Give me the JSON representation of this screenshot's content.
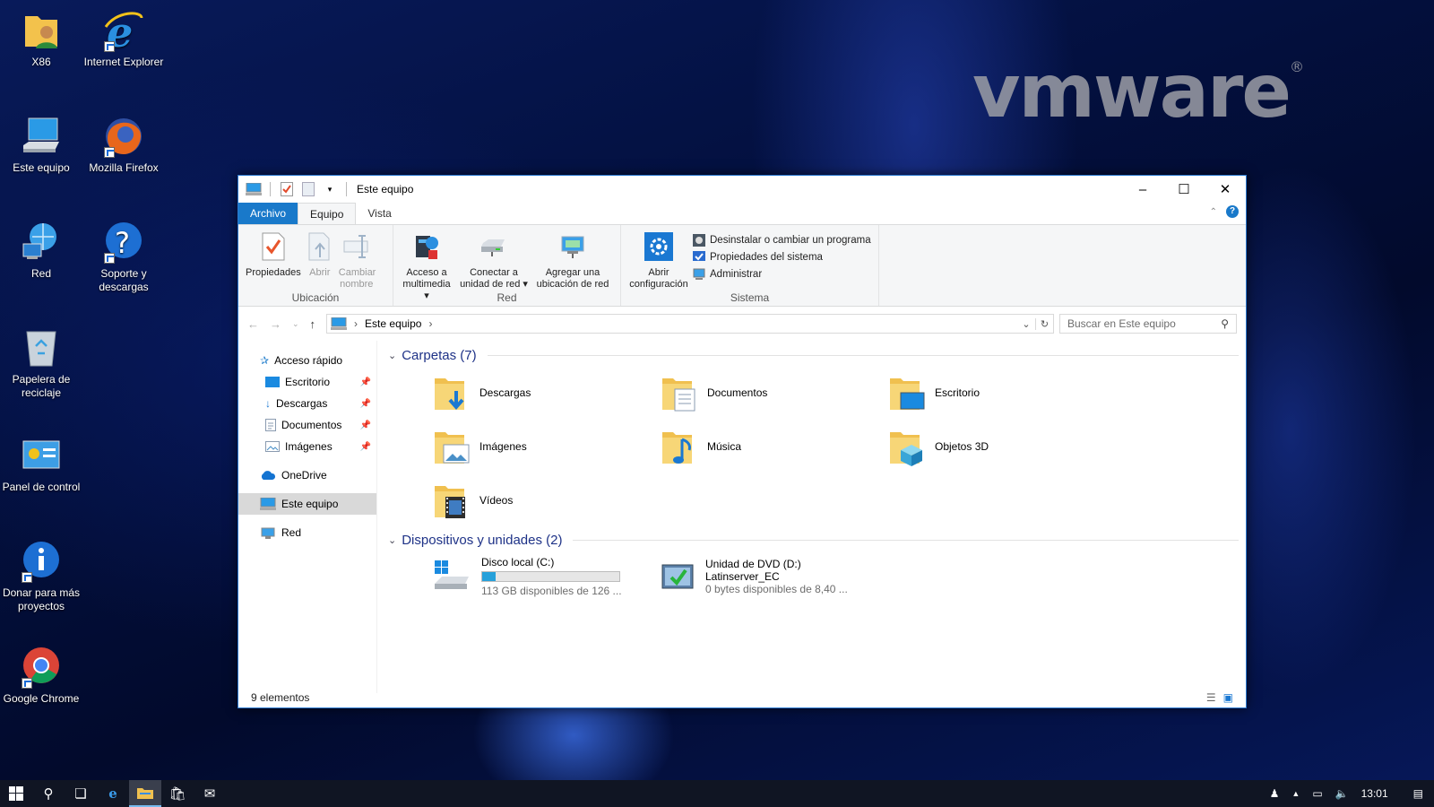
{
  "desktop": {
    "brand": "vmware",
    "icons": [
      {
        "label": "X86"
      },
      {
        "label": "Internet Explorer"
      },
      {
        "label": "Este equipo"
      },
      {
        "label": "Mozilla Firefox"
      },
      {
        "label": "Red"
      },
      {
        "label": "Soporte y descargas"
      },
      {
        "label": "Papelera de reciclaje"
      },
      {
        "label": "Panel de control"
      },
      {
        "label": "Donar para más proyectos"
      },
      {
        "label": "Google Chrome"
      }
    ]
  },
  "window": {
    "title": "Este equipo",
    "tabs": {
      "file": "Archivo",
      "computer": "Equipo",
      "view": "Vista"
    },
    "ribbon": {
      "location": {
        "label": "Ubicación",
        "properties": "Propiedades",
        "open": "Abrir",
        "rename": "Cambiar nombre"
      },
      "network": {
        "label": "Red",
        "media": "Acceso a multimedia",
        "map_drive": "Conectar a unidad de red",
        "add_location": "Agregar una ubicación de red"
      },
      "system": {
        "label": "Sistema",
        "open_settings": "Abrir configuración",
        "uninstall": "Desinstalar o cambiar un programa",
        "sys_props": "Propiedades del sistema",
        "manage": "Administrar"
      }
    },
    "address": {
      "path": "Este equipo",
      "search_placeholder": "Buscar en Este equipo"
    },
    "nav": {
      "quick_access": "Acceso rápido",
      "quick_items": [
        {
          "label": "Escritorio"
        },
        {
          "label": "Descargas"
        },
        {
          "label": "Documentos"
        },
        {
          "label": "Imágenes"
        }
      ],
      "onedrive": "OneDrive",
      "this_pc": "Este equipo",
      "network": "Red"
    },
    "folders_header": "Carpetas (7)",
    "folders": [
      {
        "name": "Descargas"
      },
      {
        "name": "Documentos"
      },
      {
        "name": "Escritorio"
      },
      {
        "name": "Imágenes"
      },
      {
        "name": "Música"
      },
      {
        "name": "Objetos 3D"
      },
      {
        "name": "Vídeos"
      }
    ],
    "devices_header": "Dispositivos y unidades (2)",
    "drives": [
      {
        "name": "Disco local (C:)",
        "free": "113 GB disponibles de 126 ...",
        "used_fraction": 0.1
      },
      {
        "name": "Unidad de DVD (D:)",
        "label": "Latinserver_EC",
        "free": "0 bytes disponibles de 8,40 ..."
      }
    ],
    "status": "9 elementos"
  },
  "taskbar": {
    "clock": "13:01"
  },
  "colors": {
    "accent": "#1979ca",
    "folder": "#f0c04f",
    "header_text": "#1e3287",
    "drive_fill": "#26a0da"
  }
}
